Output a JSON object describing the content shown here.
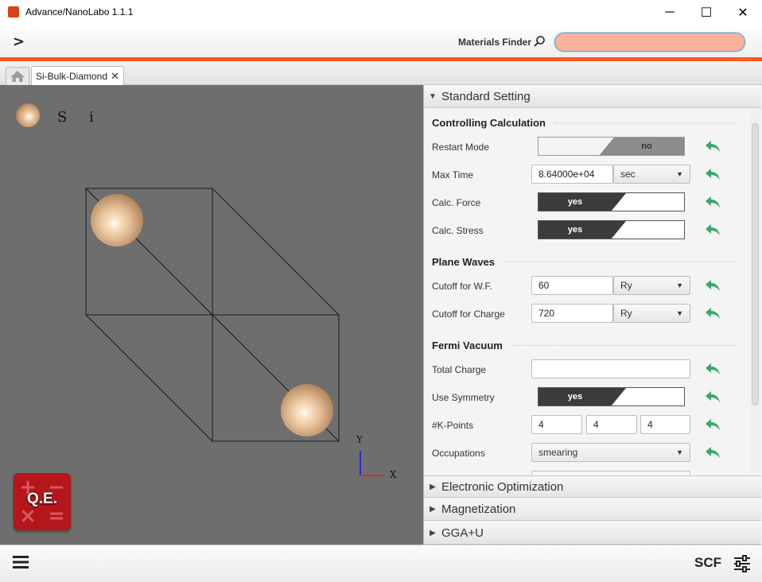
{
  "window": {
    "title": "Advance/NanoLabo 1.1.1",
    "minimize_glyph": "─",
    "maximize_glyph": "☐",
    "close_glyph": "✕"
  },
  "toolbar": {
    "nav_glyph": ">",
    "finder_label": "Materials Finder",
    "finder_icon": "search-icon",
    "finder_value": "",
    "accent_color": "#ff5a1f"
  },
  "tabs": {
    "home_icon": "home-icon",
    "document_tab_label": "Si-Bulk-Diamond",
    "document_tab_close": "✕"
  },
  "viewer": {
    "legend_element": "S i",
    "axis_y": "Y",
    "axis_x": "X",
    "badge_label": "Q.E.",
    "badge_symbols": [
      "+",
      "−",
      "×",
      "="
    ]
  },
  "panel": {
    "sections": {
      "standard": "Standard Setting",
      "electronic": "Electronic Optimization",
      "magnetization": "Magnetization",
      "ggau": "GGA+U"
    },
    "controlling": {
      "title": "Controlling Calculation",
      "restart_label": "Restart Mode",
      "restart_value": "no",
      "maxtime_label": "Max Time",
      "maxtime_value": "8.64000e+04",
      "maxtime_unit": "sec",
      "force_label": "Calc. Force",
      "force_value": "yes",
      "stress_label": "Calc. Stress",
      "stress_value": "yes"
    },
    "plane_waves": {
      "title": "Plane Waves",
      "cutoff_wf_label": "Cutoff for W.F.",
      "cutoff_wf_value": "60",
      "cutoff_wf_unit": "Ry",
      "cutoff_charge_label": "Cutoff for Charge",
      "cutoff_charge_value": "720",
      "cutoff_charge_unit": "Ry"
    },
    "fermi_vacuum": {
      "title": "Fermi Vacuum",
      "total_charge_label": "Total Charge",
      "total_charge_value": "",
      "symmetry_label": "Use Symmetry",
      "symmetry_value": "yes",
      "kpoints_label": "#K-Points",
      "kpoints": [
        "4",
        "4",
        "4"
      ],
      "occupations_label": "Occupations",
      "occupations_value": "smearing"
    },
    "reset_icon": "undo-arrow-icon",
    "reset_color": "#3aa86b"
  },
  "bottom": {
    "menu_icon": "hamburger-menu-icon",
    "mode_label": "SCF",
    "settings_icon": "sliders-icon"
  }
}
